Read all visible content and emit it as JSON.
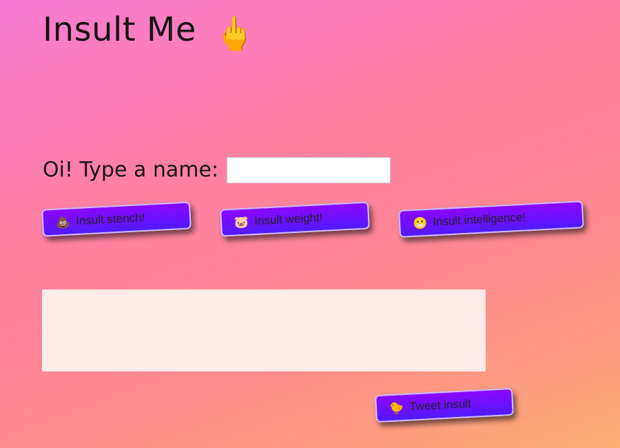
{
  "header": {
    "title": "Insult Me",
    "title_emoji": "🖕"
  },
  "form": {
    "prompt": "Oi! Type a name:",
    "name_value": "",
    "name_placeholder": ""
  },
  "buttons": {
    "stench": {
      "icon": "💩",
      "label": "Insult stench!"
    },
    "weight": {
      "icon": "🐷",
      "label": "Insult weight!"
    },
    "intelligence": {
      "icon": "😬",
      "label": "Insult intelligence!"
    },
    "tweet": {
      "icon": "🐤",
      "label": "Tweet insult"
    }
  },
  "output": {
    "text": ""
  },
  "colors": {
    "button_bg": "#7a0dff",
    "button_border": "#cdb8ff",
    "output_bg": "#fdebe7",
    "background_start": "#f77bd3",
    "background_end": "#fdae74"
  }
}
